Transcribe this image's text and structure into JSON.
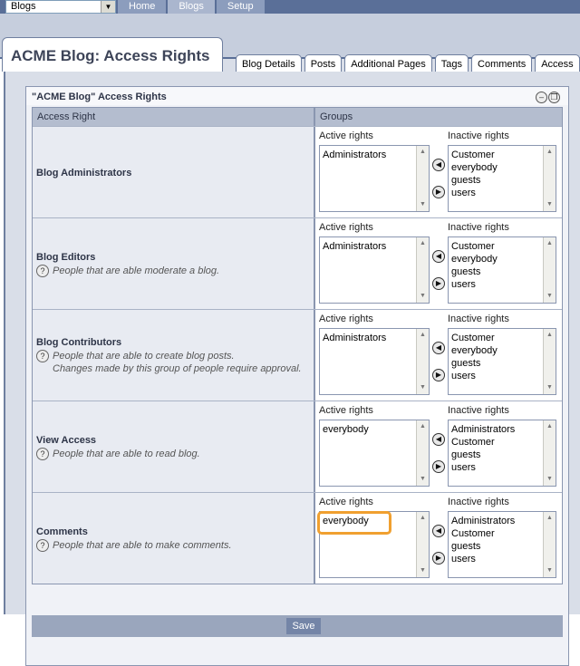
{
  "top": {
    "selector_value": "Blogs",
    "nav": [
      "Home",
      "Blogs",
      "Setup"
    ]
  },
  "page": {
    "title": "ACME Blog: Access Rights",
    "tabs": [
      "Blog Details",
      "Posts",
      "Additional Pages",
      "Tags",
      "Comments",
      "Access"
    ]
  },
  "panel": {
    "title": "\"ACME Blog\" Access Rights",
    "col_access": "Access Right",
    "col_groups": "Groups",
    "active_label": "Active rights",
    "inactive_label": "Inactive rights",
    "save_label": "Save"
  },
  "rows": [
    {
      "title": "Blog Administrators",
      "help": "",
      "active": [
        "Administrators"
      ],
      "inactive": [
        "Customer",
        "everybody",
        "guests",
        "users"
      ]
    },
    {
      "title": "Blog Editors",
      "help": "People that are able moderate a blog.",
      "active": [
        "Administrators"
      ],
      "inactive": [
        "Customer",
        "everybody",
        "guests",
        "users"
      ]
    },
    {
      "title": "Blog Contributors",
      "help": "People that are able to create blog posts.\nChanges made by this group of people require approval.",
      "active": [
        "Administrators"
      ],
      "inactive": [
        "Customer",
        "everybody",
        "guests",
        "users"
      ]
    },
    {
      "title": "View Access",
      "help": "People that are able to read blog.",
      "active": [
        "everybody"
      ],
      "inactive": [
        "Administrators",
        "Customer",
        "guests",
        "users"
      ]
    },
    {
      "title": "Comments",
      "help": "People that are able to make comments.",
      "active": [
        "everybody"
      ],
      "inactive": [
        "Administrators",
        "Customer",
        "guests",
        "users"
      ]
    }
  ],
  "colors": {
    "topbar": "#5a6f98",
    "highlight": "#f0a030"
  }
}
